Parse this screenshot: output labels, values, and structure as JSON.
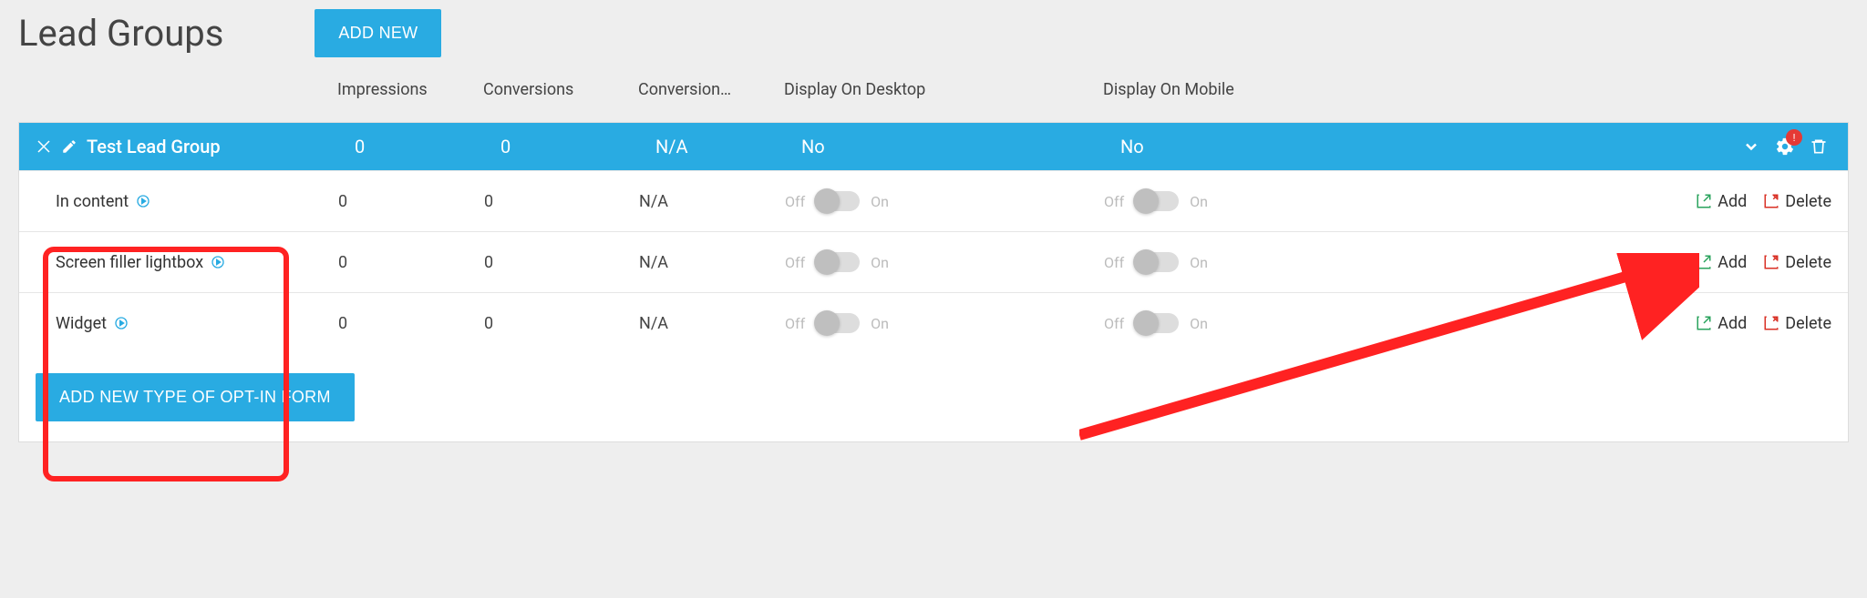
{
  "page": {
    "title": "Lead Groups"
  },
  "buttons": {
    "add_new": "ADD NEW",
    "add_new_optin": "ADD NEW TYPE OF OPT-IN FORM"
  },
  "columns": {
    "name": "",
    "impressions": "Impressions",
    "conversions": "Conversions",
    "conversion_rate": "Conversion…",
    "display_desktop": "Display On Desktop",
    "display_mobile": "Display On Mobile"
  },
  "group": {
    "name": "Test Lead Group",
    "impressions": "0",
    "conversions": "0",
    "conversion_rate": "N/A",
    "display_desktop": "No",
    "display_mobile": "No",
    "alert_badge": "!"
  },
  "toggle_labels": {
    "off": "Off",
    "on": "On"
  },
  "row_actions": {
    "add": "Add",
    "delete": "Delete"
  },
  "rows": [
    {
      "name": "In content",
      "impressions": "0",
      "conversions": "0",
      "conversion_rate": "N/A"
    },
    {
      "name": "Screen filler lightbox",
      "impressions": "0",
      "conversions": "0",
      "conversion_rate": "N/A"
    },
    {
      "name": "Widget",
      "impressions": "0",
      "conversions": "0",
      "conversion_rate": "N/A"
    }
  ]
}
